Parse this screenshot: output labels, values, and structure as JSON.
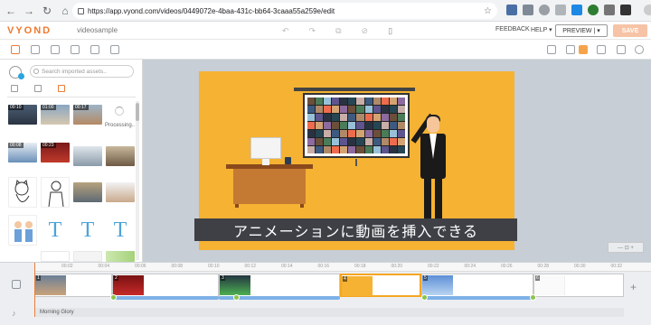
{
  "browser": {
    "url": "https://app.vyond.com/videos/0449072e-4baa-431c-bb64-3caaa55a259e/edit"
  },
  "header": {
    "logo": "VYOND",
    "project_name": "videosample",
    "feedback": "FEEDBACK",
    "help": "HELP ▾",
    "preview": "PREVIEW  |  ▾",
    "save": "SAVE"
  },
  "assets": {
    "search_placeholder": "Search imported assets..",
    "durations": [
      "00:10",
      "01:00",
      "00:17",
      "00:08",
      "00:23"
    ],
    "processing": "Processing..",
    "text_tile_glyph": "T"
  },
  "stage": {
    "subtitle": "アニメーションに動画を挿入できる",
    "zoom_label": "— ⊡ +"
  },
  "timeline": {
    "ticks": [
      "00:02",
      "00:04",
      "00:06",
      "00:08",
      "00:10",
      "00:12",
      "00:14",
      "00:16",
      "00:18",
      "00:20",
      "00:22",
      "00:24",
      "00:26",
      "00:28",
      "00:30",
      "00:32"
    ],
    "scene_numbers": [
      "1",
      "2",
      "3",
      "4",
      "5",
      "6"
    ],
    "audio_label": "Morning Glory"
  },
  "colors": {
    "accent": "#e87e3a",
    "canvas_bg": "#f5b233",
    "selected_scene": "#f5a623"
  }
}
